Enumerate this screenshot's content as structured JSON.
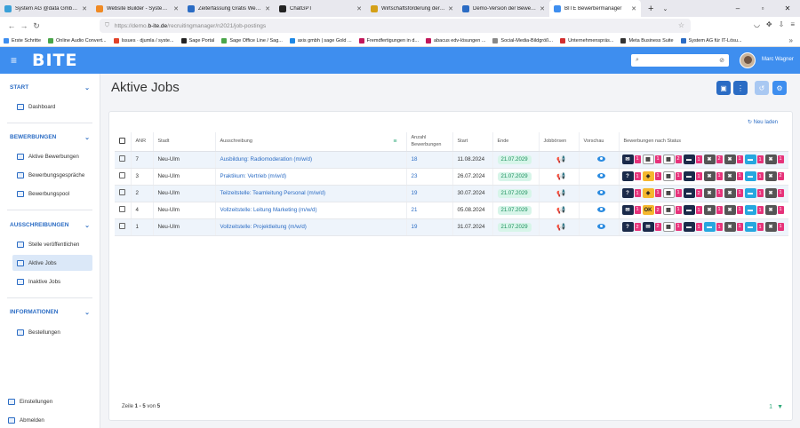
{
  "browser": {
    "tabs": [
      {
        "title": "System AG @data GmbH – B-ite",
        "color": "#3aa0d8"
      },
      {
        "title": "Website Builder - System AG @",
        "color": "#f08a24"
      },
      {
        "title": "Zeiterfassung Gratis Webinar |",
        "color": "#2b6cc4"
      },
      {
        "title": "ChatGPT",
        "color": "#222222"
      },
      {
        "title": "Wirtschaftsförderung der Stadt",
        "color": "#d4a017"
      },
      {
        "title": "Demo-Version der Bewerberm",
        "color": "#2b6cc4"
      },
      {
        "title": "BITE Bewerbermanager",
        "color": "#3e8eef"
      }
    ],
    "url_prefix": "https://demo.",
    "url_domain": "b-ite.de",
    "url_path": "/recruitingmanager/n2021/job-postings",
    "bookmarks": [
      "Erste Schritte",
      "Online Audio Convert...",
      "Issues · djumla / syste...",
      "Sage Portal",
      "Sage Office Line / Sag...",
      "axis gmbh | sage Gold ...",
      "Fremdfertigungen in d...",
      "abacus edv-lösungen ...",
      "Social-Media-Bildgröß...",
      "Unternehmenspräs...",
      "Meta Business Suite",
      "System AG für IT-Lösu..."
    ]
  },
  "app": {
    "logo": "BITE",
    "user": "Marc Wagner"
  },
  "sidebar": {
    "sections": [
      {
        "title": "START",
        "items": [
          {
            "label": "Dashboard"
          }
        ]
      },
      {
        "title": "BEWERBUNGEN",
        "items": [
          {
            "label": "Aktive Bewerbungen"
          },
          {
            "label": "Bewerbungsgespräche"
          },
          {
            "label": "Bewerbungspool"
          }
        ]
      },
      {
        "title": "AUSSCHREIBUNGEN",
        "items": [
          {
            "label": "Stelle veröffentlichen"
          },
          {
            "label": "Aktive Jobs"
          },
          {
            "label": "Inaktive Jobs"
          }
        ]
      },
      {
        "title": "INFORMATIONEN",
        "items": [
          {
            "label": "Bestellungen"
          }
        ]
      }
    ],
    "bottom": [
      {
        "label": "Einstellungen"
      },
      {
        "label": "Abmelden"
      }
    ]
  },
  "main": {
    "title": "Aktive Jobs",
    "reload_label": "Neu laden",
    "columns": [
      "ANR",
      "Stadt",
      "Ausschreibung",
      "Anzahl Bewerbungen",
      "Start",
      "Ende",
      "Jobbörsen",
      "Vorschau",
      "Bewerbungen nach Status"
    ],
    "rows": [
      {
        "anr": "7",
        "stadt": "Neu-Ulm",
        "title": "Ausbildung: Radiomoderation (m/w/d)",
        "count": "18",
        "start": "11.08.2024",
        "end": "21.07.2029",
        "stats": [
          "1",
          "1",
          "2",
          "1",
          "2",
          "1",
          "1",
          "1"
        ]
      },
      {
        "anr": "3",
        "stadt": "Neu-Ulm",
        "title": "Praktikum: Vertrieb (m/w/d)",
        "count": "23",
        "start": "26.07.2024",
        "end": "21.07.2029",
        "stats": [
          "1",
          "1",
          "1",
          "1",
          "1",
          "1",
          "1",
          "2"
        ]
      },
      {
        "anr": "2",
        "stadt": "Neu-Ulm",
        "title": "Teilzeitstelle: Teamleitung Personal (m/w/d)",
        "count": "19",
        "start": "30.07.2024",
        "end": "21.07.2029",
        "stats": [
          "1",
          "1",
          "1",
          "2",
          "1",
          "1",
          "1",
          "1"
        ]
      },
      {
        "anr": "4",
        "stadt": "Neu-Ulm",
        "title": "Vollzeitstelle: Leitung Marketing (m/w/d)",
        "count": "21",
        "start": "05.08.2024",
        "end": "21.07.2029",
        "stats": [
          "1",
          "2",
          "1",
          "1",
          "1",
          "1",
          "1",
          "1"
        ]
      },
      {
        "anr": "1",
        "stadt": "Neu-Ulm",
        "title": "Vollzeitstelle: Projektleitung (m/w/d)",
        "count": "19",
        "start": "31.07.2024",
        "end": "21.07.2029",
        "stats": [
          "2",
          "2",
          "1",
          "1",
          "1",
          "1",
          "1",
          "1"
        ]
      }
    ],
    "footer_prefix": "Zeile ",
    "footer_range": "1 - 5",
    "footer_suffix": " von ",
    "footer_total": "5",
    "filter_count": "1"
  },
  "colors": {
    "accent": "#3e8eef",
    "link": "#2b6cc4",
    "badge": "#e6337a"
  }
}
